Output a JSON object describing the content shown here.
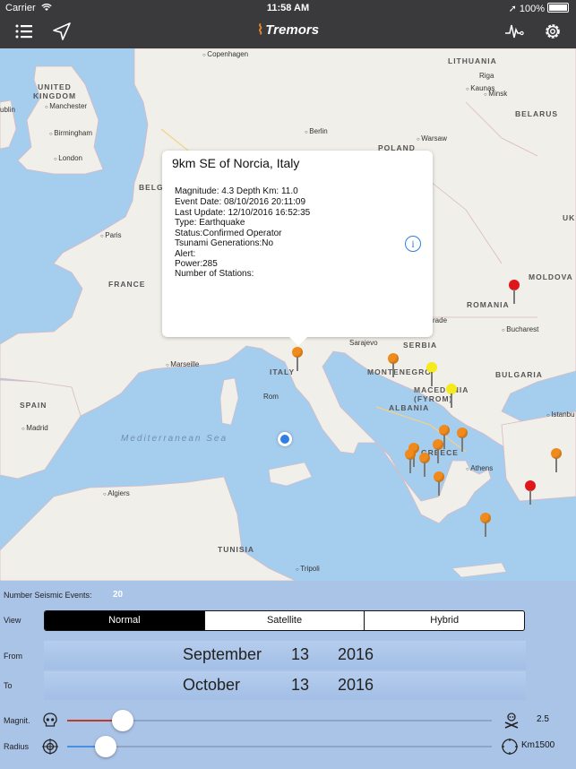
{
  "status_bar": {
    "carrier": "Carrier",
    "time": "11:58 AM",
    "battery": "100%"
  },
  "nav": {
    "title": "Tremors"
  },
  "map": {
    "labels": {
      "lithuania": "LITHUANIA",
      "uk": "UNITED KINGDOM",
      "belarus": "BELARUS",
      "poland": "POLAND",
      "france": "FRANCE",
      "romania": "ROMANIA",
      "moldova": "MOLDOVA",
      "serbia": "SERBIA",
      "italy": "ITALY",
      "montenegro": "MONTENEGRO",
      "macedonia": "MACEDONIA (FYROM)",
      "bulgaria": "BULGARIA",
      "albania": "ALBANIA",
      "greece": "GREECE",
      "spain": "SPAIN",
      "tunisia": "TUNISIA",
      "belg": "BELGI",
      "uk_right": "UK",
      "sea": "Mediterranean Sea",
      "copenhagen": "Copenhagen",
      "manchester": "Manchester",
      "birmingham": "Birmingham",
      "london": "London",
      "paris": "Paris",
      "berlin": "Berlin",
      "warsaw": "Warsaw",
      "minsk": "Minsk",
      "kaunas": "Kaunas",
      "marseille": "Marseille",
      "rome": "Rom",
      "madrid": "Madrid",
      "algiers": "Algiers",
      "athens": "Athens",
      "tripoli": "Tripoli",
      "bucharest": "Bucharest",
      "sarajevo": "Sarajevo",
      "istanbul": "Istanbu",
      "ublin": "ublin",
      "rade": "rade",
      "riga": "Riga"
    }
  },
  "callout": {
    "title": "9km SE of Norcia, Italy",
    "magnitude": "Magnitude: 4.3 Depth Km: 11.0",
    "event_date": "Event Date: 08/10/2016 20:11:09",
    "last_update": "Last Update: 12/10/2016 16:52:35",
    "type": "Type: Earthquake",
    "status": "Status:Confirmed Operator",
    "tsunami": "Tsunami Generations:No",
    "alert": "Alert:",
    "power": "Power:285",
    "stations": "Number of Stations:",
    "info_glyph": "i"
  },
  "panel": {
    "events_label": "Number Seismic Events:",
    "events_count": "20",
    "view_label": "View",
    "view_options": [
      "Normal",
      "Satellite",
      "Hybrid"
    ],
    "view_selected": "Normal",
    "from_label": "From",
    "to_label": "To",
    "from_date": {
      "month": "September",
      "day": "13",
      "year": "2016"
    },
    "to_date": {
      "month": "October",
      "day": "13",
      "year": "2016"
    },
    "magnitude_label": "Magnit.",
    "magnitude_value": "2.5",
    "radius_label": "Radius",
    "radius_value": "Km1500",
    "magnitude_slider_fraction": 0.13,
    "radius_slider_fraction": 0.09
  },
  "colors": {
    "nav_bg": "#3a3a3c",
    "panel_bg": "#aac4e8",
    "water": "#a5cdee",
    "land": "#f1efe9",
    "pin_orange": "#f08a1c",
    "pin_yellow": "#f5ea1a",
    "pin_red": "#e0161a",
    "magnitude_fill": "#c0392b",
    "radius_fill": "#4a90e2"
  },
  "icons": [
    "menu-icon",
    "location-arrow-icon",
    "seismograph-icon",
    "gear-icon",
    "info-icon",
    "skull-icon",
    "crossbones-icon",
    "crosshair-icon",
    "circle-icon",
    "wifi-icon"
  ]
}
